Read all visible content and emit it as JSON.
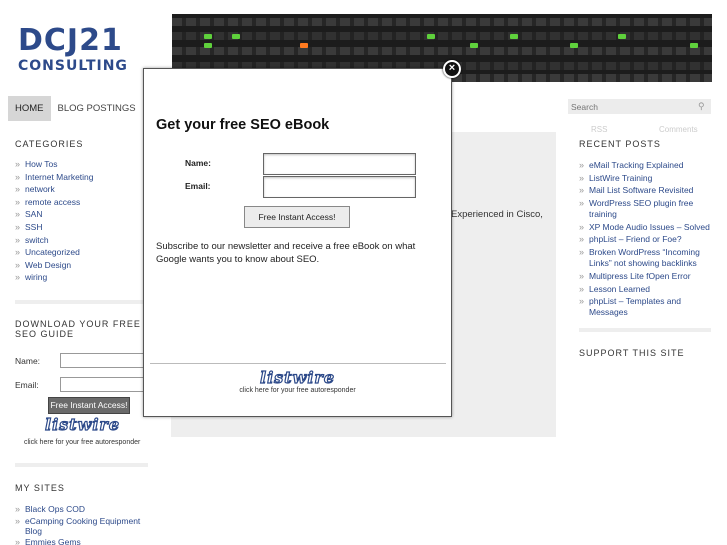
{
  "header": {
    "logo_line1": "DCJ21",
    "logo_line2": "CONSULTING"
  },
  "nav": {
    "items": [
      "HOME",
      "BLOG POSTINGS"
    ],
    "active": "HOME"
  },
  "search": {
    "placeholder": "Search"
  },
  "categories": {
    "title": "CATEGORIES",
    "items": [
      "How Tos",
      "Internet Marketing",
      "network",
      "remote access",
      "SAN",
      "SSH",
      "switch",
      "Uncategorized",
      "Web Design",
      "wiring"
    ]
  },
  "sidebar_optin": {
    "title": "DOWNLOAD YOUR FREE SEO GUIDE",
    "name_label": "Name:",
    "email_label": "Email:",
    "submit_label": "Free Instant Access!",
    "listwire_logo": "listwire",
    "listwire_caption": "click here for your free autoresponder"
  },
  "my_sites": {
    "title": "MY SITES",
    "items": [
      "Black Ops COD",
      "eCamping Cooking Equipment Blog",
      "Emmies Gems"
    ]
  },
  "content": {
    "partial_text": "Experienced in Cisco,"
  },
  "recent_posts": {
    "title": "RECENT POSTS",
    "ghost_links": [
      "RSS",
      "Comments"
    ],
    "items": [
      "eMail Tracking Explained",
      "ListWire Training",
      "Mail List Software Revisited",
      "WordPress SEO plugin free training",
      "XP Mode Audio Issues – Solved",
      "phpList – Friend or Foe?",
      "Broken WordPress “Incoming Links” not showing backlinks",
      "Multipress Lite fOpen Error",
      "Lesson Learned",
      "phpList – Templates and Messages"
    ]
  },
  "support": {
    "title": "SUPPORT THIS SITE"
  },
  "modal": {
    "title": "Get your free SEO eBook",
    "name_label": "Name:",
    "email_label": "Email:",
    "submit_label": "Free Instant Access!",
    "description": "Subscribe to our newsletter and receive a free eBook on what Google wants you to know about SEO.",
    "listwire_logo": "listwire",
    "listwire_caption": "click here for your free autoresponder",
    "close_icon": "close-icon"
  },
  "colors": {
    "link": "#2d4a8a",
    "logo": "#2d4a8a",
    "nav_active_bg": "#d6d6d6",
    "content_bg": "#eeeeee"
  }
}
